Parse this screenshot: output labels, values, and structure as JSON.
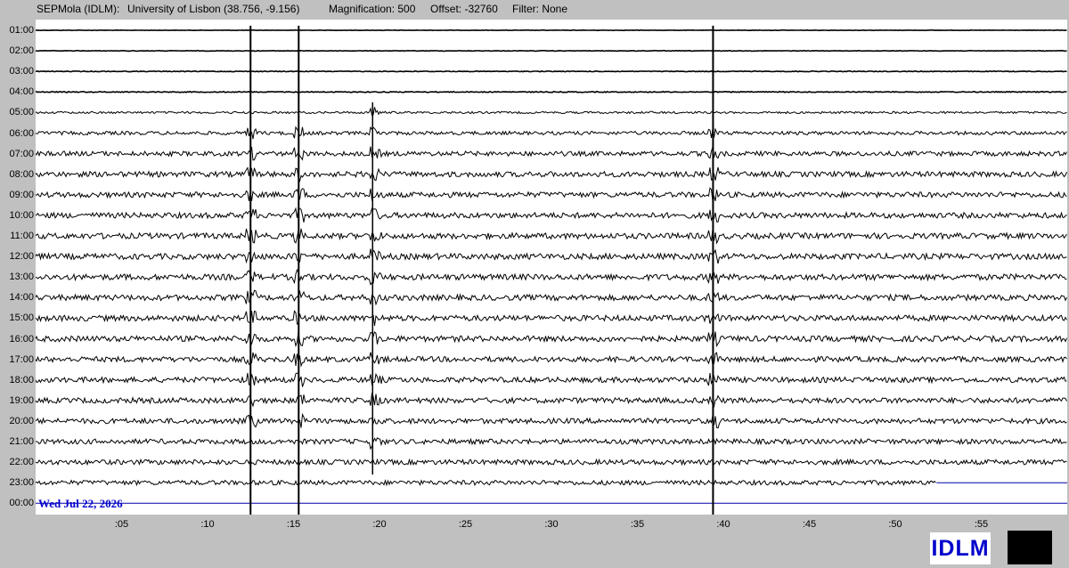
{
  "header": {
    "station": "SEPMola (IDLM):",
    "location": "University of Lisbon (38.756, -9.156)",
    "magnification": "Magnification: 500",
    "offset": "Offset: -32760",
    "filter": "Filter: None"
  },
  "hour_labels": [
    "01:00",
    "02:00",
    "03:00",
    "04:00",
    "05:00",
    "06:00",
    "07:00",
    "08:00",
    "09:00",
    "10:00",
    "11:00",
    "12:00",
    "13:00",
    "14:00",
    "15:00",
    "16:00",
    "17:00",
    "18:00",
    "19:00",
    "20:00",
    "21:00",
    "22:00",
    "23:00",
    "00:00"
  ],
  "minute_ticks": [
    ":05",
    ":10",
    ":15",
    ":20",
    ":25",
    ":30",
    ":35",
    ":40",
    ":45",
    ":50",
    ":55"
  ],
  "date_label": "Wed Jul 22, 2026",
  "logo_text": "IDLM",
  "colors": {
    "background": "#c0c0c0",
    "plot_background": "#ffffff",
    "trace": "#000000",
    "date_text": "#0000cc",
    "last_row_line": "#0000aa"
  },
  "trace_data": {
    "minutes_per_row": 60,
    "last_row_end_minute": 52.4,
    "noise_levels": [
      0.25,
      0.3,
      0.4,
      0.5,
      1.2,
      2.0,
      2.6,
      3.0,
      3.0,
      3.1,
      3.2,
      3.3,
      3.3,
      3.2,
      3.2,
      3.2,
      3.0,
      3.0,
      3.0,
      2.9,
      2.8,
      2.8,
      2.6,
      0
    ],
    "vertical_spikes_minutes": [
      12.5,
      15.3,
      39.4
    ],
    "burst_minutes": [
      19.6
    ]
  }
}
